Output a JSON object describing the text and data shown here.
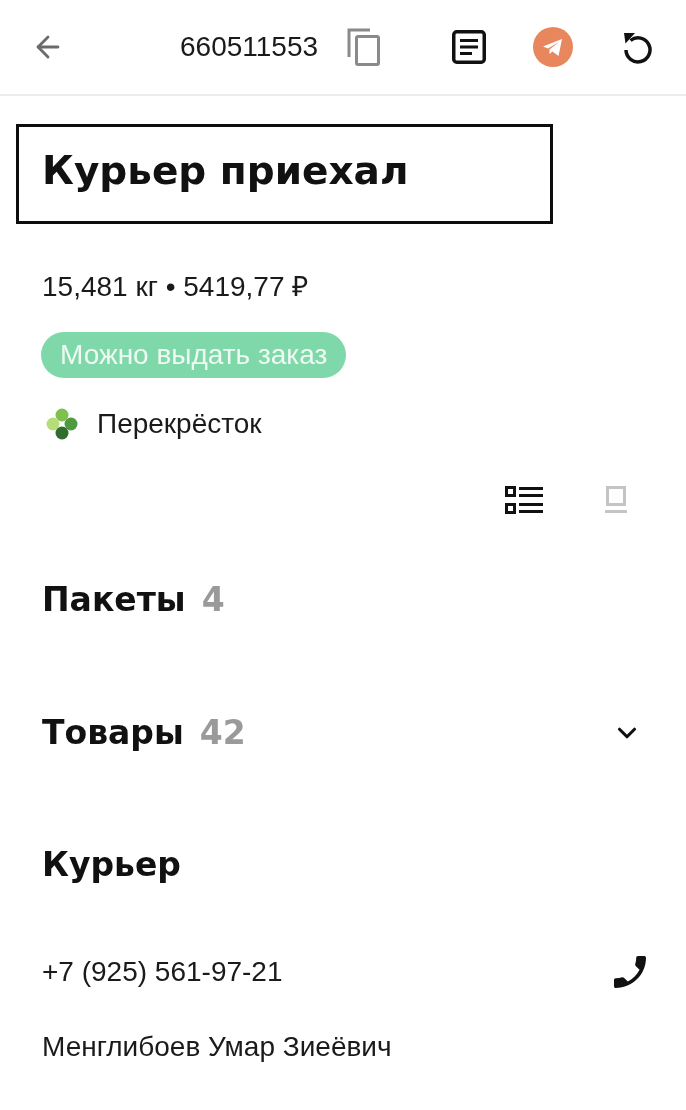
{
  "header": {
    "order_number": "660511553"
  },
  "status": {
    "title": "Курьер приехал"
  },
  "summary": "15,481 кг • 5419,77 ₽",
  "badge": "Можно выдать заказ",
  "store": {
    "name": "Перекрёсток"
  },
  "view_modes": [
    {
      "kind": "list",
      "selected": true
    },
    {
      "kind": "tile",
      "selected": false
    }
  ],
  "sections": [
    {
      "title": "Пакеты",
      "count": "4"
    },
    {
      "title": "Товары",
      "count": "42",
      "expanded": false
    }
  ],
  "courier": {
    "title": "Курьер",
    "phone": "+7 (925) 561-97-21",
    "name": "Менглибоев Умар Зиеёвич"
  }
}
